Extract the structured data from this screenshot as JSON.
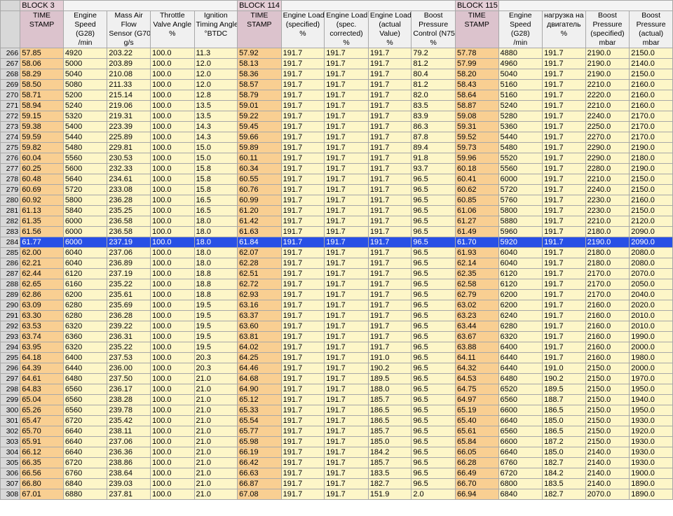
{
  "blocks": [
    {
      "label": "BLOCK 3",
      "span": 5
    },
    {
      "label": "BLOCK 114",
      "span": 5
    },
    {
      "label": "BLOCK 115",
      "span": 5
    }
  ],
  "headers": [
    {
      "lines": [
        "TIME",
        "STAMP"
      ],
      "unit": "",
      "ts": true
    },
    {
      "lines": [
        "Engine",
        "Speed",
        "(G28)"
      ],
      "unit": "/min"
    },
    {
      "lines": [
        "Mass Air",
        "Flow",
        "Sensor (G70)"
      ],
      "unit": "g/s"
    },
    {
      "lines": [
        "Throttle",
        "Valve Angle"
      ],
      "unit": "%"
    },
    {
      "lines": [
        "Ignition",
        "Timing Angle"
      ],
      "unit": "°BTDC"
    },
    {
      "lines": [
        "TIME",
        "STAMP"
      ],
      "unit": "",
      "ts": true
    },
    {
      "lines": [
        "Engine Load",
        "(specified)"
      ],
      "unit": "%"
    },
    {
      "lines": [
        "Engine Load",
        "(spec.",
        "corrected)"
      ],
      "unit": "%"
    },
    {
      "lines": [
        "Engine Load",
        "(actual",
        "Value)"
      ],
      "unit": "%"
    },
    {
      "lines": [
        "Boost",
        "Pressure",
        "Control (N75)"
      ],
      "unit": "%"
    },
    {
      "lines": [
        "TIME",
        "STAMP"
      ],
      "unit": "",
      "ts": true
    },
    {
      "lines": [
        "Engine",
        "Speed",
        "(G28)"
      ],
      "unit": "/min"
    },
    {
      "lines": [
        "нагрузка на",
        "двигатель"
      ],
      "unit": "%"
    },
    {
      "lines": [
        "Boost",
        "Pressure",
        "(specified)"
      ],
      "unit": "mbar"
    },
    {
      "lines": [
        "Boost",
        "Pressure",
        "(actual)"
      ],
      "unit": "mbar"
    }
  ],
  "selected_row": "284",
  "rows": [
    [
      "266",
      "57.85",
      "4920",
      "203.22",
      "100.0",
      "11.3",
      "57.92",
      "191.7",
      "191.7",
      "191.7",
      "79.2",
      "57.78",
      "4880",
      "191.7",
      "2190.0",
      "2150.0"
    ],
    [
      "267",
      "58.06",
      "5000",
      "203.89",
      "100.0",
      "12.0",
      "58.13",
      "191.7",
      "191.7",
      "191.7",
      "81.2",
      "57.99",
      "4960",
      "191.7",
      "2190.0",
      "2140.0"
    ],
    [
      "268",
      "58.29",
      "5040",
      "210.08",
      "100.0",
      "12.0",
      "58.36",
      "191.7",
      "191.7",
      "191.7",
      "80.4",
      "58.20",
      "5040",
      "191.7",
      "2190.0",
      "2150.0"
    ],
    [
      "269",
      "58.50",
      "5080",
      "211.33",
      "100.0",
      "12.0",
      "58.57",
      "191.7",
      "191.7",
      "191.7",
      "81.2",
      "58.43",
      "5160",
      "191.7",
      "2210.0",
      "2160.0"
    ],
    [
      "270",
      "58.71",
      "5200",
      "215.14",
      "100.0",
      "12.8",
      "58.79",
      "191.7",
      "191.7",
      "191.7",
      "82.0",
      "58.64",
      "5160",
      "191.7",
      "2220.0",
      "2160.0"
    ],
    [
      "271",
      "58.94",
      "5240",
      "219.06",
      "100.0",
      "13.5",
      "59.01",
      "191.7",
      "191.7",
      "191.7",
      "83.5",
      "58.87",
      "5240",
      "191.7",
      "2210.0",
      "2160.0"
    ],
    [
      "272",
      "59.15",
      "5320",
      "219.31",
      "100.0",
      "13.5",
      "59.22",
      "191.7",
      "191.7",
      "191.7",
      "83.9",
      "59.08",
      "5280",
      "191.7",
      "2240.0",
      "2170.0"
    ],
    [
      "273",
      "59.38",
      "5400",
      "223.39",
      "100.0",
      "14.3",
      "59.45",
      "191.7",
      "191.7",
      "191.7",
      "86.3",
      "59.31",
      "5360",
      "191.7",
      "2250.0",
      "2170.0"
    ],
    [
      "274",
      "59.59",
      "5440",
      "225.89",
      "100.0",
      "14.3",
      "59.66",
      "191.7",
      "191.7",
      "191.7",
      "87.8",
      "59.52",
      "5440",
      "191.7",
      "2270.0",
      "2170.0"
    ],
    [
      "275",
      "59.82",
      "5480",
      "229.81",
      "100.0",
      "15.0",
      "59.89",
      "191.7",
      "191.7",
      "191.7",
      "89.4",
      "59.73",
      "5480",
      "191.7",
      "2290.0",
      "2190.0"
    ],
    [
      "276",
      "60.04",
      "5560",
      "230.53",
      "100.0",
      "15.0",
      "60.11",
      "191.7",
      "191.7",
      "191.7",
      "91.8",
      "59.96",
      "5520",
      "191.7",
      "2290.0",
      "2180.0"
    ],
    [
      "277",
      "60.25",
      "5600",
      "232.33",
      "100.0",
      "15.8",
      "60.34",
      "191.7",
      "191.7",
      "191.7",
      "93.7",
      "60.18",
      "5560",
      "191.7",
      "2280.0",
      "2190.0"
    ],
    [
      "278",
      "60.48",
      "5640",
      "234.61",
      "100.0",
      "15.8",
      "60.55",
      "191.7",
      "191.7",
      "191.7",
      "96.5",
      "60.41",
      "6000",
      "191.7",
      "2210.0",
      "2150.0"
    ],
    [
      "279",
      "60.69",
      "5720",
      "233.08",
      "100.0",
      "15.8",
      "60.76",
      "191.7",
      "191.7",
      "191.7",
      "96.5",
      "60.62",
      "5720",
      "191.7",
      "2240.0",
      "2150.0"
    ],
    [
      "280",
      "60.92",
      "5800",
      "236.28",
      "100.0",
      "16.5",
      "60.99",
      "191.7",
      "191.7",
      "191.7",
      "96.5",
      "60.85",
      "5760",
      "191.7",
      "2230.0",
      "2160.0"
    ],
    [
      "281",
      "61.13",
      "5840",
      "235.25",
      "100.0",
      "16.5",
      "61.20",
      "191.7",
      "191.7",
      "191.7",
      "96.5",
      "61.06",
      "5800",
      "191.7",
      "2230.0",
      "2150.0"
    ],
    [
      "282",
      "61.35",
      "6000",
      "236.58",
      "100.0",
      "18.0",
      "61.42",
      "191.7",
      "191.7",
      "191.7",
      "96.5",
      "61.27",
      "5880",
      "191.7",
      "2210.0",
      "2120.0"
    ],
    [
      "283",
      "61.56",
      "6000",
      "236.58",
      "100.0",
      "18.0",
      "61.63",
      "191.7",
      "191.7",
      "191.7",
      "96.5",
      "61.49",
      "5960",
      "191.7",
      "2180.0",
      "2090.0"
    ],
    [
      "284",
      "61.77",
      "6000",
      "237.19",
      "100.0",
      "18.0",
      "61.84",
      "191.7",
      "191.7",
      "191.7",
      "96.5",
      "61.70",
      "5920",
      "191.7",
      "2190.0",
      "2090.0"
    ],
    [
      "285",
      "62.00",
      "6040",
      "237.06",
      "100.0",
      "18.0",
      "62.07",
      "191.7",
      "191.7",
      "191.7",
      "96.5",
      "61.93",
      "6040",
      "191.7",
      "2180.0",
      "2080.0"
    ],
    [
      "286",
      "62.21",
      "6040",
      "236.89",
      "100.0",
      "18.0",
      "62.28",
      "191.7",
      "191.7",
      "191.7",
      "96.5",
      "62.14",
      "6040",
      "191.7",
      "2180.0",
      "2080.0"
    ],
    [
      "287",
      "62.44",
      "6120",
      "237.19",
      "100.0",
      "18.8",
      "62.51",
      "191.7",
      "191.7",
      "191.7",
      "96.5",
      "62.35",
      "6120",
      "191.7",
      "2170.0",
      "2070.0"
    ],
    [
      "288",
      "62.65",
      "6160",
      "235.22",
      "100.0",
      "18.8",
      "62.72",
      "191.7",
      "191.7",
      "191.7",
      "96.5",
      "62.58",
      "6120",
      "191.7",
      "2170.0",
      "2050.0"
    ],
    [
      "289",
      "62.86",
      "6200",
      "235.61",
      "100.0",
      "18.8",
      "62.93",
      "191.7",
      "191.7",
      "191.7",
      "96.5",
      "62.79",
      "6200",
      "191.7",
      "2170.0",
      "2040.0"
    ],
    [
      "290",
      "63.09",
      "6280",
      "235.69",
      "100.0",
      "19.5",
      "63.16",
      "191.7",
      "191.7",
      "191.7",
      "96.5",
      "63.02",
      "6200",
      "191.7",
      "2160.0",
      "2020.0"
    ],
    [
      "291",
      "63.30",
      "6280",
      "236.28",
      "100.0",
      "19.5",
      "63.37",
      "191.7",
      "191.7",
      "191.7",
      "96.5",
      "63.23",
      "6240",
      "191.7",
      "2160.0",
      "2010.0"
    ],
    [
      "292",
      "63.53",
      "6320",
      "239.22",
      "100.0",
      "19.5",
      "63.60",
      "191.7",
      "191.7",
      "191.7",
      "96.5",
      "63.44",
      "6280",
      "191.7",
      "2160.0",
      "2010.0"
    ],
    [
      "293",
      "63.74",
      "6360",
      "236.31",
      "100.0",
      "19.5",
      "63.81",
      "191.7",
      "191.7",
      "191.7",
      "96.5",
      "63.67",
      "6320",
      "191.7",
      "2160.0",
      "1990.0"
    ],
    [
      "294",
      "63.95",
      "6320",
      "235.22",
      "100.0",
      "19.5",
      "64.02",
      "191.7",
      "191.7",
      "191.7",
      "96.5",
      "63.88",
      "6400",
      "191.7",
      "2160.0",
      "2000.0"
    ],
    [
      "295",
      "64.18",
      "6400",
      "237.53",
      "100.0",
      "20.3",
      "64.25",
      "191.7",
      "191.7",
      "191.0",
      "96.5",
      "64.11",
      "6440",
      "191.7",
      "2160.0",
      "1980.0"
    ],
    [
      "296",
      "64.39",
      "6440",
      "236.00",
      "100.0",
      "20.3",
      "64.46",
      "191.7",
      "191.7",
      "190.2",
      "96.5",
      "64.32",
      "6440",
      "191.0",
      "2150.0",
      "2000.0"
    ],
    [
      "297",
      "64.61",
      "6480",
      "237.50",
      "100.0",
      "21.0",
      "64.68",
      "191.7",
      "191.7",
      "189.5",
      "96.5",
      "64.53",
      "6480",
      "190.2",
      "2150.0",
      "1970.0"
    ],
    [
      "298",
      "64.83",
      "6560",
      "236.17",
      "100.0",
      "21.0",
      "64.90",
      "191.7",
      "191.7",
      "188.0",
      "96.5",
      "64.75",
      "6520",
      "189.5",
      "2150.0",
      "1950.0"
    ],
    [
      "299",
      "65.04",
      "6560",
      "238.28",
      "100.0",
      "21.0",
      "65.12",
      "191.7",
      "191.7",
      "185.7",
      "96.5",
      "64.97",
      "6560",
      "188.7",
      "2150.0",
      "1940.0"
    ],
    [
      "300",
      "65.26",
      "6560",
      "239.78",
      "100.0",
      "21.0",
      "65.33",
      "191.7",
      "191.7",
      "186.5",
      "96.5",
      "65.19",
      "6600",
      "186.5",
      "2150.0",
      "1950.0"
    ],
    [
      "301",
      "65.47",
      "6720",
      "235.42",
      "100.0",
      "21.0",
      "65.54",
      "191.7",
      "191.7",
      "186.5",
      "96.5",
      "65.40",
      "6640",
      "185.0",
      "2150.0",
      "1930.0"
    ],
    [
      "302",
      "65.70",
      "6640",
      "238.11",
      "100.0",
      "21.0",
      "65.77",
      "191.7",
      "191.7",
      "185.7",
      "96.5",
      "65.61",
      "6560",
      "186.5",
      "2150.0",
      "1920.0"
    ],
    [
      "303",
      "65.91",
      "6640",
      "237.06",
      "100.0",
      "21.0",
      "65.98",
      "191.7",
      "191.7",
      "185.0",
      "96.5",
      "65.84",
      "6600",
      "187.2",
      "2150.0",
      "1930.0"
    ],
    [
      "304",
      "66.12",
      "6640",
      "236.36",
      "100.0",
      "21.0",
      "66.19",
      "191.7",
      "191.7",
      "184.2",
      "96.5",
      "66.05",
      "6640",
      "185.0",
      "2140.0",
      "1930.0"
    ],
    [
      "305",
      "66.35",
      "6720",
      "238.86",
      "100.0",
      "21.0",
      "66.42",
      "191.7",
      "191.7",
      "185.7",
      "96.5",
      "66.28",
      "6760",
      "182.7",
      "2140.0",
      "1930.0"
    ],
    [
      "306",
      "66.56",
      "6760",
      "238.64",
      "100.0",
      "21.0",
      "66.63",
      "191.7",
      "191.7",
      "183.5",
      "96.5",
      "66.49",
      "6720",
      "184.2",
      "2140.0",
      "1900.0"
    ],
    [
      "307",
      "66.80",
      "6840",
      "239.03",
      "100.0",
      "21.0",
      "66.87",
      "191.7",
      "191.7",
      "182.7",
      "96.5",
      "66.70",
      "6800",
      "183.5",
      "2140.0",
      "1890.0"
    ],
    [
      "308",
      "67.01",
      "6880",
      "237.81",
      "100.0",
      "21.0",
      "67.08",
      "191.7",
      "191.7",
      "151.9",
      "2.0",
      "66.94",
      "6840",
      "182.7",
      "2070.0",
      "1890.0"
    ]
  ]
}
